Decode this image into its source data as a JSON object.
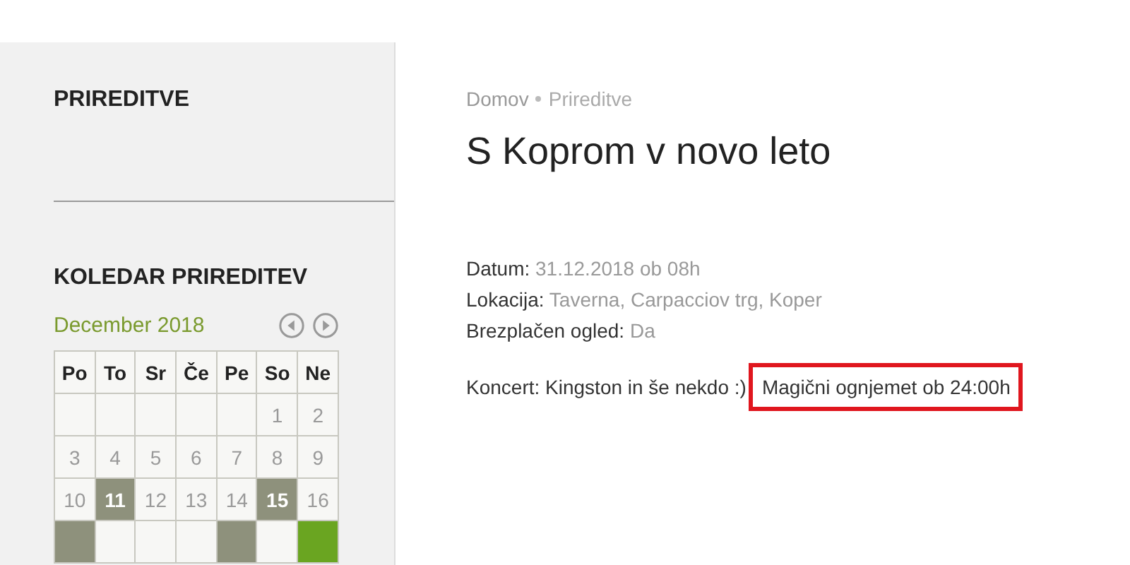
{
  "sidebar": {
    "title": "PRIREDITVE",
    "calendar_title": "KOLEDAR PRIREDITEV",
    "calendar": {
      "month": "December 2018",
      "weekdays": [
        "Po",
        "To",
        "Sr",
        "Če",
        "Pe",
        "So",
        "Ne"
      ],
      "weeks": [
        [
          {
            "kind": "empty"
          },
          {
            "kind": "empty"
          },
          {
            "kind": "empty"
          },
          {
            "kind": "empty"
          },
          {
            "kind": "empty"
          },
          {
            "kind": "day",
            "day": "1"
          },
          {
            "kind": "day",
            "day": "2"
          }
        ],
        [
          {
            "kind": "day",
            "day": "3"
          },
          {
            "kind": "day",
            "day": "4"
          },
          {
            "kind": "day",
            "day": "5"
          },
          {
            "kind": "day",
            "day": "6"
          },
          {
            "kind": "day",
            "day": "7"
          },
          {
            "kind": "day",
            "day": "8"
          },
          {
            "kind": "day",
            "day": "9"
          }
        ],
        [
          {
            "kind": "day",
            "day": "10"
          },
          {
            "kind": "event",
            "day": "11"
          },
          {
            "kind": "day",
            "day": "12"
          },
          {
            "kind": "day",
            "day": "13"
          },
          {
            "kind": "day",
            "day": "14"
          },
          {
            "kind": "event",
            "day": "15"
          },
          {
            "kind": "day",
            "day": "16"
          }
        ],
        [
          {
            "kind": "event"
          },
          {
            "kind": "day"
          },
          {
            "kind": "day"
          },
          {
            "kind": "day"
          },
          {
            "kind": "event"
          },
          {
            "kind": "day"
          },
          {
            "kind": "today"
          }
        ]
      ]
    }
  },
  "breadcrumb": [
    "Domov",
    "Prireditve"
  ],
  "title": "S Koprom v novo leto",
  "details": [
    {
      "label": "Datum:",
      "value": "31.12.2018 ob 08h"
    },
    {
      "label": "Lokacija:",
      "value": "Taverna, Carpacciov trg, Koper"
    },
    {
      "label": "Brezplačen ogled:",
      "value": "Da"
    }
  ],
  "description": [
    {
      "text": "Koncert: Kingston in še nekdo :)",
      "highlighted": false
    },
    {
      "text": "Magični ognjemet ob 24:00h",
      "highlighted": true
    }
  ]
}
